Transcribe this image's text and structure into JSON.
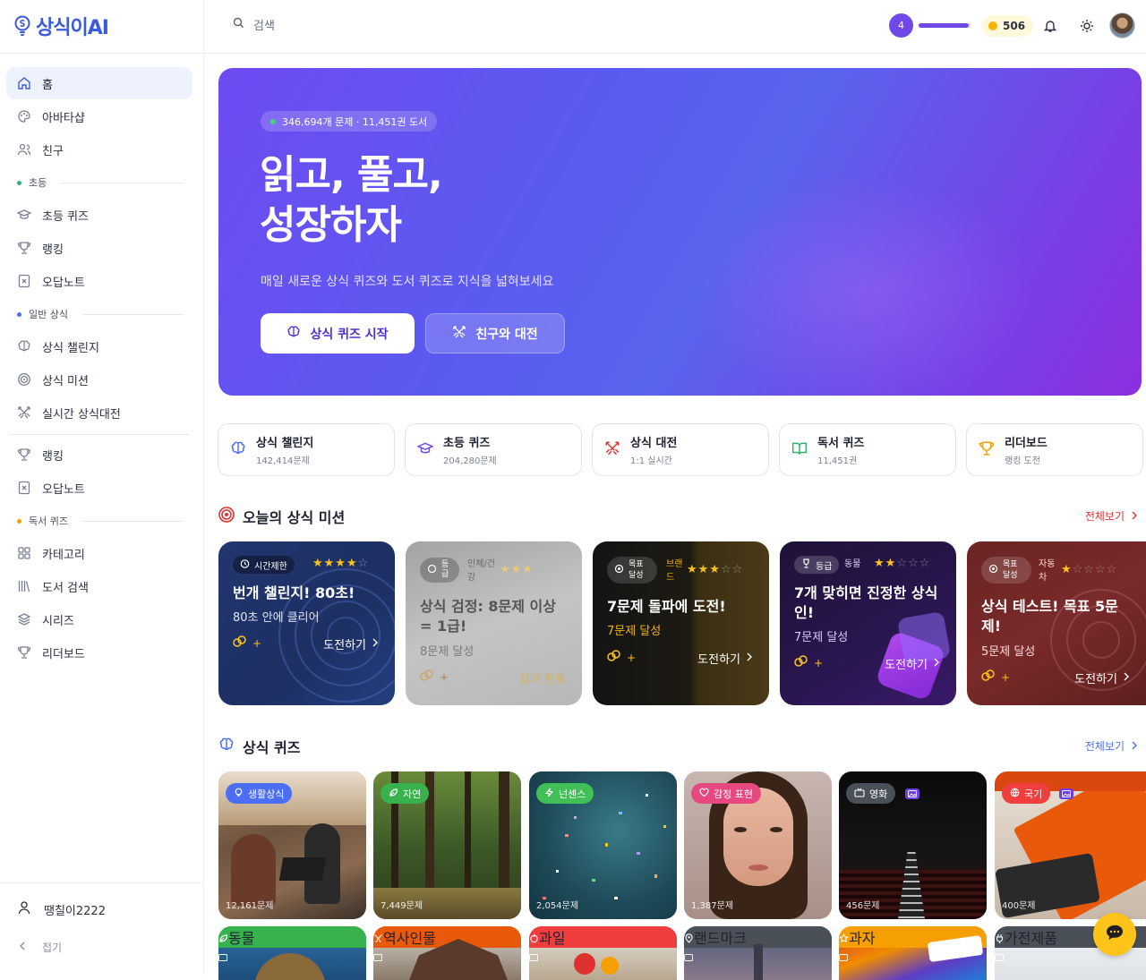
{
  "brand": {
    "name": "상식이AI"
  },
  "sidebar": {
    "items": [
      {
        "label": "홈",
        "icon": "home-icon"
      },
      {
        "label": "아바타샵",
        "icon": "palette-icon"
      },
      {
        "label": "친구",
        "icon": "users-icon"
      }
    ],
    "sections": [
      {
        "title": "초등",
        "dot": "#2fb36a",
        "items": [
          {
            "label": "초등 퀴즈",
            "icon": "graduation-cap-icon"
          },
          {
            "label": "랭킹",
            "icon": "trophy-icon"
          },
          {
            "label": "오답노트",
            "icon": "wrong-note-icon"
          }
        ]
      },
      {
        "title": "일반 상식",
        "dot": "#4c6ef5",
        "items": [
          {
            "label": "상식 챌린지",
            "icon": "brain-icon"
          },
          {
            "label": "상식 미션",
            "icon": "target-icon"
          },
          {
            "label": "실시간 상식대전",
            "icon": "swords-icon"
          }
        ]
      },
      {
        "extra": [
          {
            "label": "랭킹",
            "icon": "trophy-icon"
          },
          {
            "label": "오답노트",
            "icon": "wrong-note-icon"
          }
        ]
      },
      {
        "title": "독서 퀴즈",
        "dot": "#f59f00",
        "items": [
          {
            "label": "카테고리",
            "icon": "grid-icon"
          },
          {
            "label": "도서 검색",
            "icon": "library-icon"
          },
          {
            "label": "시리즈",
            "icon": "layers-icon"
          },
          {
            "label": "리더보드",
            "icon": "trophy-icon"
          }
        ]
      }
    ],
    "user": "땡칠이2222",
    "fold": "접기"
  },
  "topbar": {
    "search_placeholder": "검색",
    "level": "4",
    "xp_fraction": 0.95,
    "coins": "506"
  },
  "hero": {
    "pill": "346,694개 문제 · 11,451권 도서",
    "title_line1": "읽고, 풀고,",
    "title_line2": "성장하자",
    "subtitle": "매일 새로운 상식 퀴즈와 도서 퀴즈로 지식을 넓혀보세요",
    "primary_btn": "상식 퀴즈 시작",
    "secondary_btn": "친구와 대전"
  },
  "tiles": [
    {
      "title": "상식 챌린지",
      "sub": "142,414문제",
      "icon": "brain-icon",
      "color": "#4c6ef5"
    },
    {
      "title": "초등 퀴즈",
      "sub": "204,280문제",
      "icon": "graduation-cap-icon",
      "color": "#7048e8"
    },
    {
      "title": "상식 대전",
      "sub": "1:1 실시간",
      "icon": "swords-icon",
      "color": "#e03131"
    },
    {
      "title": "독서 퀴즈",
      "sub": "11,451권",
      "icon": "book-open-icon",
      "color": "#2fb36a"
    },
    {
      "title": "리더보드",
      "sub": "랭킹 도전",
      "icon": "trophy-icon",
      "color": "#f59f00"
    }
  ],
  "missions": {
    "title": "오늘의 상식 미션",
    "more": "전체보기",
    "cards": [
      {
        "tag": "시간제한",
        "stars": 4,
        "title": "번개 챌린지! 80초!",
        "sub": "80초 안에 클리어",
        "reward": "+",
        "action": "도전하기"
      },
      {
        "tag": "등급",
        "category": "인체/건강",
        "stars": 3,
        "title": "상식 검정: 8문제 이상 = 1급!",
        "sub": "8문제 달성",
        "reward": "+",
        "action": "참여 완료"
      },
      {
        "tag": "목표달성",
        "category": "브랜드",
        "stars": 3,
        "title": "7문제 돌파에 도전!",
        "sub": "7문제 달성",
        "reward": "+",
        "action": "도전하기"
      },
      {
        "tag": "등급",
        "category": "동물",
        "stars": 2,
        "title": "7개 맞히면 진정한 상식인!",
        "sub": "7문제 달성",
        "reward": "+",
        "action": "도전하기"
      },
      {
        "tag": "목표달성",
        "category": "자동차",
        "stars": 1,
        "title": "상식 테스트! 목표 5문제!",
        "sub": "5문제 달성",
        "reward": "+",
        "action": "도전하기"
      }
    ]
  },
  "quiz": {
    "title": "상식 퀴즈",
    "more": "전체보기",
    "cards": [
      {
        "label": "생활상식",
        "count": "12,161문제",
        "color": "#4c6ef5",
        "icon": "bulb-icon"
      },
      {
        "label": "자연",
        "count": "7,449문제",
        "color": "#37b24d",
        "icon": "leaf-icon"
      },
      {
        "label": "넌센스",
        "count": "2,054문제",
        "color": "#40c057",
        "icon": "bolt-icon"
      },
      {
        "label": "감정 표현",
        "count": "1,387문제",
        "color": "#e64980",
        "icon": "heart-icon"
      },
      {
        "label": "영화",
        "count": "456문제",
        "color": "#495057",
        "icon": "tv-icon"
      },
      {
        "label": "국기",
        "count": "400문제",
        "color": "#f03e3e",
        "icon": "globe-icon"
      }
    ],
    "row2": [
      {
        "label": "동물",
        "color": "#37b24d",
        "icon": "leaf-icon"
      },
      {
        "label": "역사인물",
        "color": "#e8590c",
        "icon": "swords-icon"
      },
      {
        "label": "과일",
        "color": "#f03e3e",
        "icon": "apple-icon"
      },
      {
        "label": "랜드마크",
        "color": "#495057",
        "icon": "pin-icon"
      },
      {
        "label": "과자",
        "color": "#f59f00",
        "icon": "star-icon"
      },
      {
        "label": "가전제품",
        "color": "#495057",
        "icon": "plug-icon"
      }
    ]
  }
}
